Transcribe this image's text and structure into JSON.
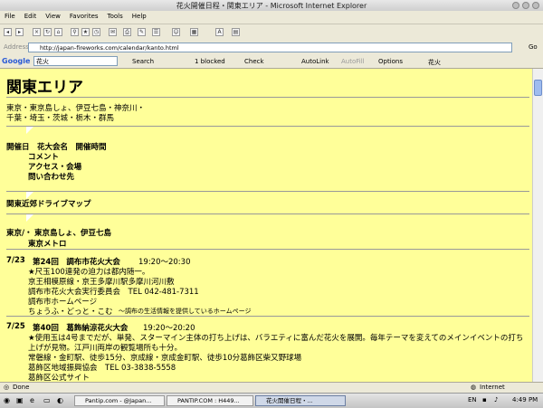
{
  "window": {
    "title": "花火開催日程・関東エリア - Microsoft Internet Explorer"
  },
  "menu": [
    "File",
    "Edit",
    "View",
    "Favorites",
    "Tools",
    "Help"
  ],
  "address": {
    "label": "Address",
    "url": "http://japan-fireworks.com/calendar/kanto.html",
    "go": "Go"
  },
  "google": {
    "logo": "Google",
    "query": "花火",
    "search": "Search",
    "blocked": "1 blocked",
    "check": "Check",
    "autolink": "AutoLink",
    "autofill": "AutoFill",
    "options": "Options",
    "fire": "花火"
  },
  "page": {
    "title": "関東エリア",
    "regions_line1": "東京・東京島しょ、伊豆七島・神奈川・",
    "regions_line2": "千葉・埼玉・茨城・栃木・群馬",
    "legend": {
      "line1": "開催日　花大会名　開催時間",
      "line2": "コメント",
      "line3": "アクセス・会場",
      "line4": "問い合わせ先"
    },
    "drive_map": "関東近郊ドライブマップ",
    "tokyo_label": "東京/・",
    "tokyo_islands": "東京島しょ、伊豆七島",
    "tokyo_metro": "東京メトロ",
    "event1": {
      "date": "7/23",
      "name": "第24回　調布市花火大会",
      "time": "19:20～20:30",
      "comment": "★尺玉100連発の迫力は都内随一。",
      "access": "京王相模原線・京王多摩川駅多摩川河川敷",
      "contact": "調布市花火大会実行委員会　TEL 042-481-7311",
      "home": "調布市ホームページ",
      "subnote_link": "ちょうふ・どっと・こむ",
      "subnote": "～調布の生活情報を提供しているホームページ"
    },
    "event2": {
      "date": "7/25",
      "name": "第40回　葛飾納涼花火大会",
      "time": "19:20～20:20",
      "comment1": "★使用玉は4号までだが、単発、スターマイン主体の打ち上げは、バラエティに富んだ花火を展開。毎年テーマを変えてのメインイベントの打ち",
      "comment2": "上げが見物。江戸川両岸の観覧場所も十分。",
      "access": "常磐線・金町駅、徒歩15分、京成線・京成金町駅、徒歩10分葛飾区柴又野球場",
      "contact": "葛飾区地域振興協会　TEL 03-3838-5558",
      "site": "葛飾区公式サイト"
    }
  },
  "status": {
    "left": "Done",
    "zone": "Internet"
  },
  "taskbar": {
    "items": [
      "Pantip.com - @Japan...",
      "PANTIP.COM : H449...",
      "花火開催日程・..."
    ],
    "lang": "EN",
    "clock": "4:49 PM"
  }
}
